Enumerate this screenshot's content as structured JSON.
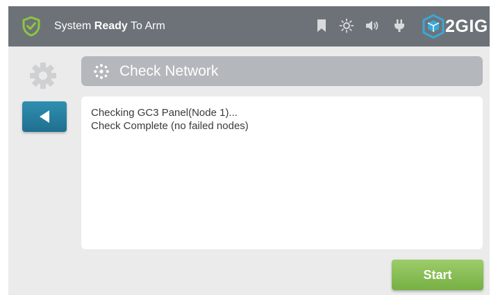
{
  "status_bar": {
    "status_prefix": "System ",
    "status_bold": "Ready",
    "status_suffix": " To Arm",
    "icons": [
      "shield-check-icon",
      "bookmark-icon",
      "brightness-icon",
      "volume-icon",
      "power-plug-icon"
    ],
    "brand_logo": "2GIG"
  },
  "sidebar": {
    "icons": [
      "gear-icon",
      "back-arrow-icon"
    ]
  },
  "header": {
    "title": "Check Network",
    "icon": "network-nodes-icon"
  },
  "output": {
    "lines": [
      "Checking GC3 Panel(Node 1)...",
      "Check Complete (no failed nodes)"
    ]
  },
  "actions": {
    "start_label": "Start"
  },
  "colors": {
    "top_bar": "#6d7278",
    "screen_background": "#ebebeb",
    "title_bar": "#b4b7bb",
    "back_button": "#2a84a7",
    "start_button": "#88bf55",
    "status_shield": "#8cc63f",
    "brand_cube": "#3aa8d8"
  }
}
